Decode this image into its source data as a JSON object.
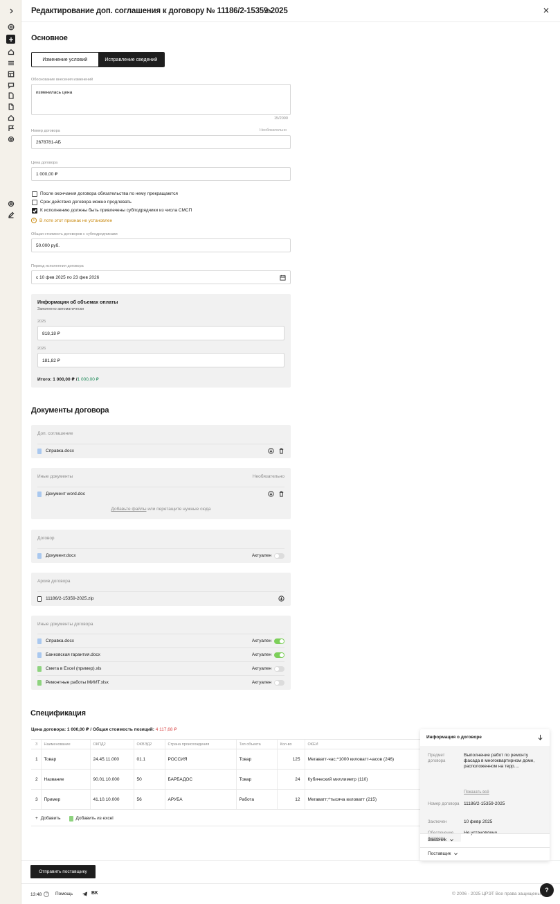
{
  "header": {
    "title": "Редактирование доп. соглашения к договору № 11186/2-15359-2025"
  },
  "sections": {
    "basic": "Основное",
    "documents": "Документы договора",
    "spec": "Спецификация"
  },
  "mode_toggle": {
    "option1": "Изменение условий",
    "option2": "Исправление сведений",
    "selected": "Исправление сведений"
  },
  "justification": {
    "label": "Обоснование внесения изменений",
    "value": "изменилась цена",
    "counter": "15/2000"
  },
  "contract_number": {
    "label": "Номер договора",
    "optional": "Необязательно",
    "value": "2678781-АБ"
  },
  "contract_price": {
    "label": "Цена договора",
    "value": "1 000,00 ₽"
  },
  "checkboxes": [
    {
      "label": "После окончания договора обязательства по нему прекращаются",
      "checked": false
    },
    {
      "label": "Срок действия договора можно продлевать",
      "checked": false
    },
    {
      "label": "К исполнению должны быть привлечены субподрядчики из числа СМСП",
      "checked": true
    }
  ],
  "warning": "В лоте этот признак не установлен",
  "subcontract_total": {
    "label": "Общая стоимость договоров с субподрядчиками",
    "value": "50.000 руб."
  },
  "period": {
    "label": "Период исполнения договора",
    "value": "с 10 фев 2025 по 23 фев 2026"
  },
  "payments": {
    "title": "Информация об объемах оплаты",
    "subtitle": "Заполнено автоматически",
    "year1": "2025",
    "value1": "818,18 ₽",
    "year2": "2026",
    "value2": "181,82 ₽",
    "total_prefix": "Итого: 1 000,00 ₽ /",
    "total_value": "1 000,00 ₽"
  },
  "docs": {
    "supplement": {
      "title": "Доп. соглашение",
      "file": "Справка.docx"
    },
    "other": {
      "title": "Иные документы",
      "optional": "Необязательно",
      "file": "Документ word.doc",
      "drop_link": "Добавьте файлы",
      "drop_text": " или перетащите нужные сюда"
    },
    "contract": {
      "title": "Договор",
      "file": "Документ.docx",
      "status": "Актуален"
    },
    "archive": {
      "title": "Архив договора",
      "file": "11186/2-15359-2025.zip"
    },
    "other_contract": {
      "title": "Иные документы договора",
      "items": [
        {
          "file": "Справка.docx",
          "status": "Актуален",
          "on": true,
          "type": "doc"
        },
        {
          "file": "Банковская гарантия.docx",
          "status": "Актуален",
          "on": true,
          "type": "doc"
        },
        {
          "file": "Смета в Excel (пример).xls",
          "status": "Актуален",
          "on": false,
          "type": "xls"
        },
        {
          "file": "Ремонтные работы МИИТ.xlsx",
          "status": "Актуален",
          "on": false,
          "type": "xls"
        }
      ]
    }
  },
  "spec": {
    "price_prefix": "Цена договора: 1 000,00 ₽ / Общая стоимость позиций: ",
    "price_total": "4 117,68 ₽",
    "columns": [
      "З",
      "Наименование",
      "ОКПД2",
      "ОКВЭД2",
      "Страна происхождения",
      "Тип объекта",
      "Кол-во",
      "ОКЕИ"
    ],
    "rows": [
      [
        "1",
        "Товар",
        "24.45.11.000",
        "01.1",
        "РОССИЯ",
        "Товар",
        "125",
        "Мегаватт-час;^1000 киловатт-часов (246)"
      ],
      [
        "2",
        "Название",
        "90.01.10.000",
        "50",
        "БАРБАДОС",
        "Товар",
        "24",
        "Кубический миллиметр (110)"
      ],
      [
        "3",
        "Пример",
        "41.10.10.000",
        "56",
        "АРУБА",
        "Работа",
        "12",
        "Мегаватт;^тысяча киловатт (215)"
      ]
    ],
    "add": "Добавить",
    "add_excel": "Добавить из excel"
  },
  "info_panel": {
    "title": "Информация о договоре",
    "subject_k": "Предмет договора",
    "subject_v": "Выполнение работ по ремонту фасада в многоквартирном доме, расположенном на терр....",
    "show_all": "Показать всё",
    "number_k": "Номер договора",
    "number_v": "11186/2-15359-2025",
    "concluded_k": "Заключен",
    "concluded_v": "10 февр 2025",
    "security_k": "Обеспечение договора",
    "security_v": "Не установлено",
    "customer": "Заказчик",
    "supplier": "Поставщик"
  },
  "footer": {
    "submit": "Отправить поставщику",
    "time": "13:48",
    "help": "Помощь",
    "vk": "ВК",
    "copyright": "© 2006 - 2025 ЦРЭТ Все права защищены",
    "question": "?"
  }
}
